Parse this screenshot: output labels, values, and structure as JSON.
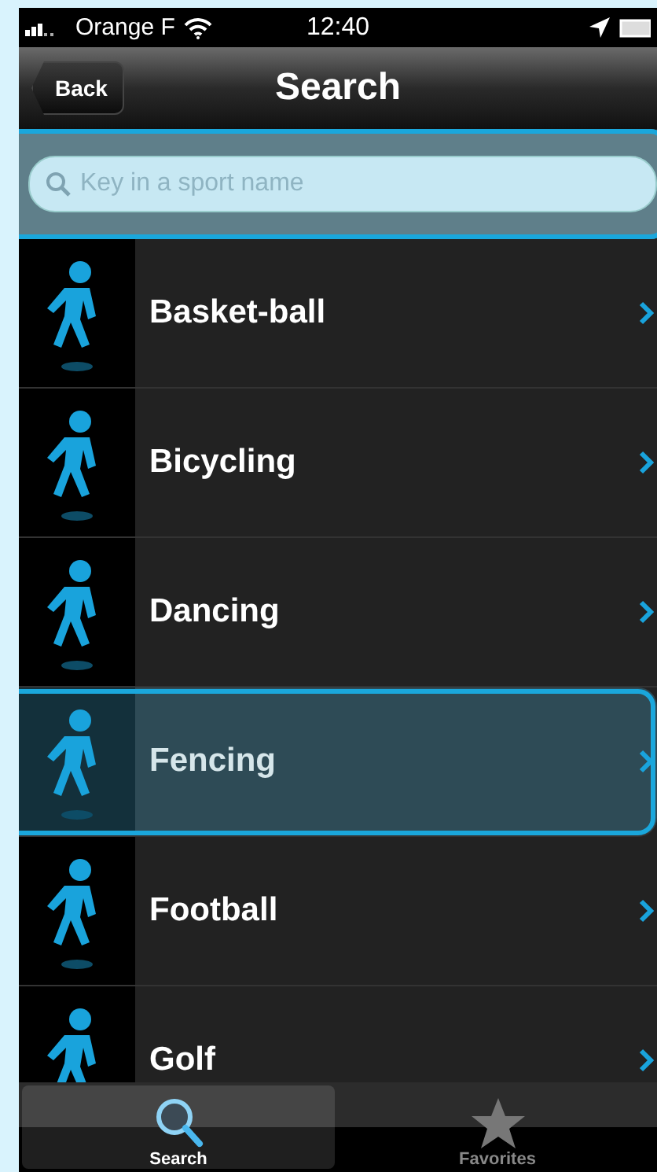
{
  "status_bar": {
    "carrier": "Orange F",
    "time": "12:40"
  },
  "nav_bar": {
    "back": "Back",
    "title": "Search"
  },
  "search": {
    "placeholder": "Key in a sport name",
    "focused": true
  },
  "sports": [
    {
      "name": "Basket-ball",
      "selected": false
    },
    {
      "name": "Bicycling",
      "selected": false
    },
    {
      "name": "Dancing",
      "selected": false
    },
    {
      "name": "Fencing",
      "selected": true
    },
    {
      "name": "Football",
      "selected": false
    },
    {
      "name": "Golf",
      "selected": false
    }
  ],
  "tabs": [
    {
      "label": "Search",
      "kind": "search",
      "selected": true
    },
    {
      "label": "Favorites",
      "kind": "star",
      "selected": false
    }
  ]
}
